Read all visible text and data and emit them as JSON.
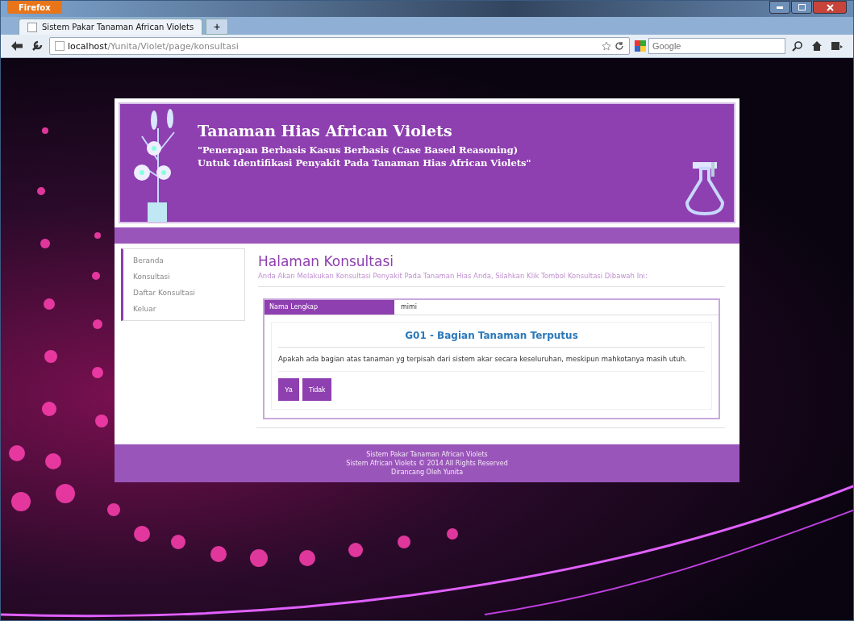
{
  "browser": {
    "menu_button": "Firefox",
    "tabs": [
      {
        "title": "Sistem Pakar Tanaman African Violets",
        "selected": true
      }
    ],
    "new_tab": "+",
    "url_host": "localhost",
    "url_path": "/Yunita/Violet/page/konsultasi",
    "search_placeholder": "Google"
  },
  "header": {
    "title": "Tanaman Hias African Violets",
    "subtitle_lines": [
      "\"Penerapan Berbasis Kasus Berbasis (Case Based Reasoning)",
      "Untuk Identifikasi Penyakit Pada Tanaman Hias African Violets\""
    ]
  },
  "sidebar": {
    "items": [
      {
        "label": "Beranda"
      },
      {
        "label": "Konsultasi"
      },
      {
        "label": "Daftar Konsultasi"
      },
      {
        "label": "Keluar"
      }
    ]
  },
  "content": {
    "heading": "Halaman Konsultasi",
    "intro": "Anda Akan Melakukan Konsultasi Penyakit Pada Tanaman Hias Anda, Silahkan Klik Tombol Konsultasi Dibawah Ini:",
    "name_label": "Nama Lengkap",
    "name_value": "mimi",
    "question_title": "G01 - Bagian Tanaman Terputus",
    "question_text": "Apakah ada bagian atas tanaman yg terpisah dari sistem akar secara keseluruhan, meskipun mahkotanya masih utuh.",
    "buttons": [
      "Ya",
      "Tidak"
    ]
  },
  "footer": {
    "lines": [
      "Sistem Pakar Tanaman African Violets",
      "Sistem African Violets © 2014 All Rights Reserved",
      "Dirancang Oleh Yunita"
    ]
  }
}
